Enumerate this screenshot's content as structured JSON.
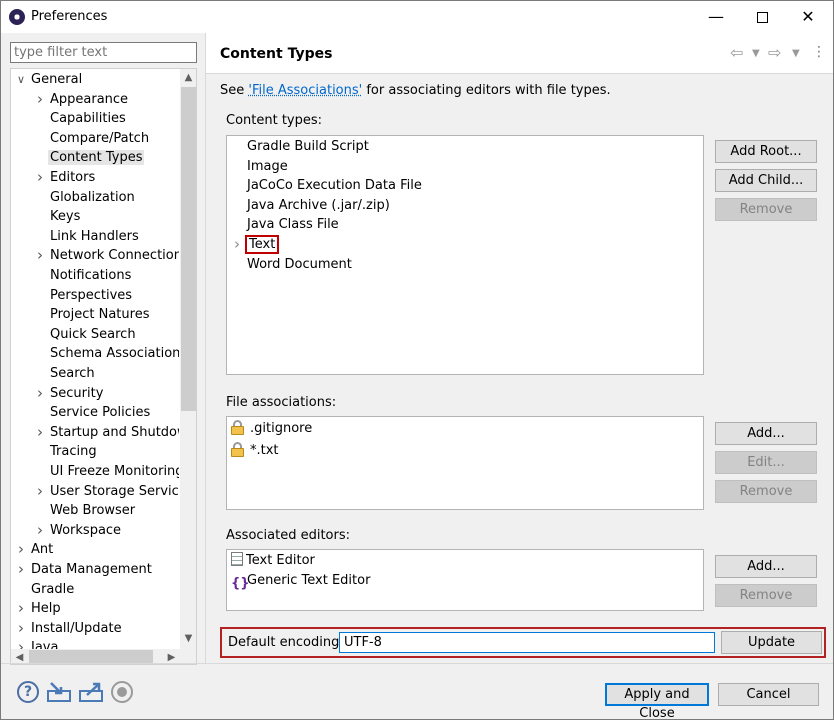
{
  "window": {
    "title": "Preferences"
  },
  "filter": {
    "placeholder": "type filter text"
  },
  "tree": {
    "items": [
      {
        "label": "General",
        "level": 0,
        "expander": "expanded"
      },
      {
        "label": "Appearance",
        "level": 1,
        "expander": "collapsed"
      },
      {
        "label": "Capabilities",
        "level": 1,
        "expander": "none"
      },
      {
        "label": "Compare/Patch",
        "level": 1,
        "expander": "none"
      },
      {
        "label": "Content Types",
        "level": 1,
        "expander": "none",
        "selected": true
      },
      {
        "label": "Editors",
        "level": 1,
        "expander": "collapsed"
      },
      {
        "label": "Globalization",
        "level": 1,
        "expander": "none"
      },
      {
        "label": "Keys",
        "level": 1,
        "expander": "none"
      },
      {
        "label": "Link Handlers",
        "level": 1,
        "expander": "none"
      },
      {
        "label": "Network Connections",
        "level": 1,
        "expander": "collapsed"
      },
      {
        "label": "Notifications",
        "level": 1,
        "expander": "none"
      },
      {
        "label": "Perspectives",
        "level": 1,
        "expander": "none"
      },
      {
        "label": "Project Natures",
        "level": 1,
        "expander": "none"
      },
      {
        "label": "Quick Search",
        "level": 1,
        "expander": "none"
      },
      {
        "label": "Schema Associations",
        "level": 1,
        "expander": "none"
      },
      {
        "label": "Search",
        "level": 1,
        "expander": "none"
      },
      {
        "label": "Security",
        "level": 1,
        "expander": "collapsed"
      },
      {
        "label": "Service Policies",
        "level": 1,
        "expander": "none"
      },
      {
        "label": "Startup and Shutdown",
        "level": 1,
        "expander": "collapsed"
      },
      {
        "label": "Tracing",
        "level": 1,
        "expander": "none"
      },
      {
        "label": "UI Freeze Monitoring",
        "level": 1,
        "expander": "none"
      },
      {
        "label": "User Storage Service",
        "level": 1,
        "expander": "collapsed"
      },
      {
        "label": "Web Browser",
        "level": 1,
        "expander": "none"
      },
      {
        "label": "Workspace",
        "level": 1,
        "expander": "collapsed"
      },
      {
        "label": "Ant",
        "level": 0,
        "expander": "collapsed"
      },
      {
        "label": "Data Management",
        "level": 0,
        "expander": "collapsed"
      },
      {
        "label": "Gradle",
        "level": 0,
        "expander": "none"
      },
      {
        "label": "Help",
        "level": 0,
        "expander": "collapsed"
      },
      {
        "label": "Install/Update",
        "level": 0,
        "expander": "collapsed"
      },
      {
        "label": "Java",
        "level": 0,
        "expander": "collapsed"
      }
    ]
  },
  "page": {
    "title": "Content Types",
    "desc_prefix": "See ",
    "desc_link": "'File Associations'",
    "desc_suffix": " for associating editors with file types.",
    "content_types_label": "Content types:",
    "content_types": [
      "Gradle Build Script",
      "Image",
      "JaCoCo Execution Data File",
      "Java Archive (.jar/.zip)",
      "Java Class File",
      "Text",
      "Word Document"
    ],
    "selected_content_type": "Text",
    "add_root": "Add Root...",
    "add_child": "Add Child...",
    "remove": "Remove",
    "file_assoc_label": "File associations:",
    "file_assocs": [
      ".gitignore",
      "*.txt"
    ],
    "fa_add": "Add...",
    "fa_edit": "Edit...",
    "fa_remove": "Remove",
    "editors_label": "Associated editors:",
    "editors": [
      "Text Editor",
      "Generic Text Editor"
    ],
    "ed_add": "Add...",
    "ed_remove": "Remove",
    "encoding_label": "Default encoding:",
    "encoding_value": "UTF-8",
    "update": "Update"
  },
  "footer": {
    "apply_close": "Apply and Close",
    "cancel": "Cancel"
  },
  "colors": {
    "highlight_outline": "#c00000",
    "link": "#0066cc"
  }
}
